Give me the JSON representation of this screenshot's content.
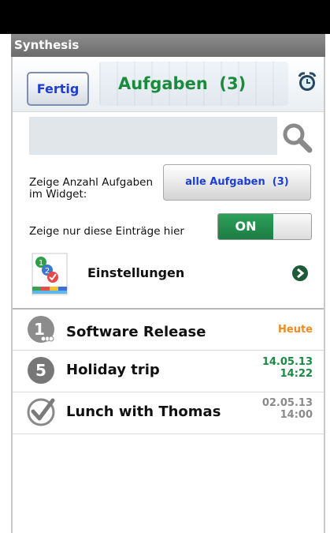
{
  "app_title": "Synthesis",
  "header": {
    "fertig_label": "Fertig",
    "title": "Aufgaben  (3)"
  },
  "search": {
    "placeholder": "",
    "value": ""
  },
  "widget_setting": {
    "label_line1": "Zeige Anzahl Aufgaben",
    "label_line2": "im Widget:",
    "button_label": "alle Aufgaben  (3)"
  },
  "show_only_setting": {
    "label": "Zeige nur diese Einträge hier",
    "toggle_label": "ON"
  },
  "settings_link": {
    "label": "Einstellungen"
  },
  "tasks": [
    {
      "badge": "1",
      "title": "Software Release",
      "date_line1": "Heute",
      "date_line2": "",
      "date_color": "#f08c1e"
    },
    {
      "badge": "5",
      "title": "Holiday trip",
      "date_line1": "14.05.13",
      "date_line2": "14:22",
      "date_color": "#1a8a40"
    },
    {
      "badge": "",
      "title": "Lunch with Thomas",
      "date_line1": "02.05.13",
      "date_line2": "14:00",
      "date_color": "#8a8a8a"
    }
  ],
  "colors": {
    "accent_green": "#1c8a3c",
    "link_blue": "#1d3fd1",
    "today_orange": "#f08c1e"
  }
}
